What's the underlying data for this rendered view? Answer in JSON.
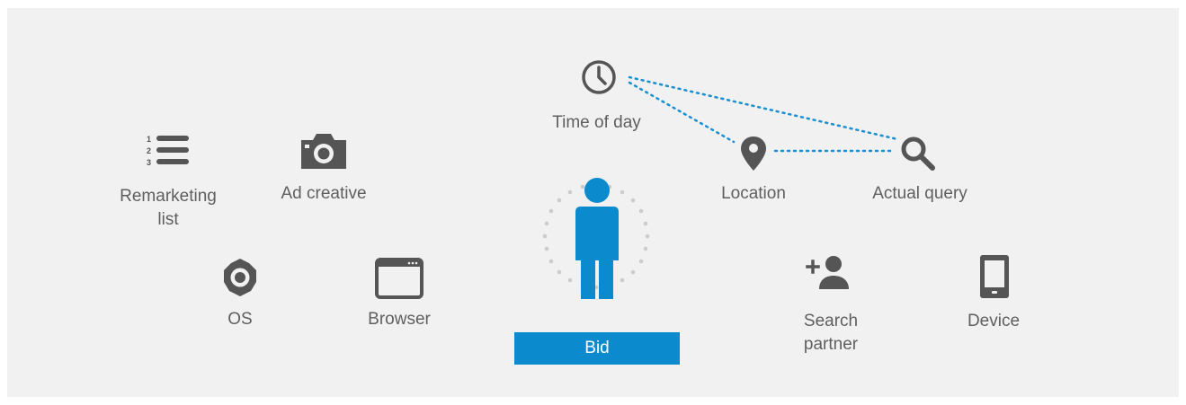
{
  "bid": {
    "label": "Bid"
  },
  "signals": {
    "time_of_day": {
      "label": "Time of day",
      "icon": "clock-icon"
    },
    "location": {
      "label": "Location",
      "icon": "map-pin-icon"
    },
    "actual_query": {
      "label": "Actual query",
      "icon": "search-icon"
    },
    "remarketing_list": {
      "label_line1": "Remarketing",
      "label_line2": "list",
      "icon": "numbered-list-icon"
    },
    "ad_creative": {
      "label": "Ad creative",
      "icon": "camera-icon"
    },
    "os": {
      "label": "OS",
      "icon": "gear-icon"
    },
    "browser": {
      "label": "Browser",
      "icon": "browser-window-icon"
    },
    "search_partner": {
      "label_line1": "Search",
      "label_line2": "partner",
      "icon": "add-person-icon"
    },
    "device": {
      "label": "Device",
      "icon": "tablet-icon"
    }
  },
  "colors": {
    "accent": "#0b8ace",
    "icon": "#555555",
    "text": "#5f5f5f",
    "background": "#f1f1f1",
    "halo": "#cccccc"
  }
}
